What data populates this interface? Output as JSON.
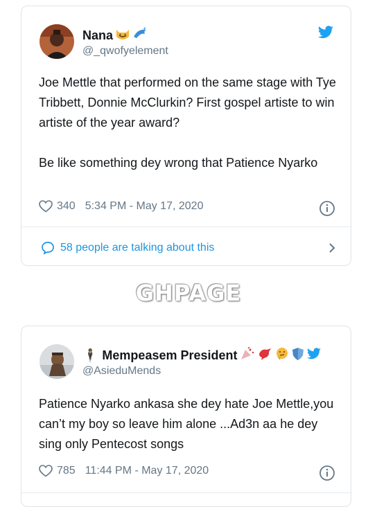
{
  "tweet1": {
    "name": "Nana",
    "handle": "@_qwofyelement",
    "text": "Joe Mettle that performed on the same stage with Tye Tribbett, Donnie McClurkin? First gospel artiste to win artiste of the year award?\n\nBe like something dey wrong that Patience Nyarko",
    "likes": "340",
    "timestamp": "5:34 PM - May 17, 2020",
    "talking": "58 people are talking about this"
  },
  "watermark": "GHPAGE",
  "tweet2": {
    "name_prefix": "🕴",
    "name": "Mempeasem President",
    "handle": "@AsieduMends",
    "text": "Patience Nyarko ankasa she dey hate Joe Mettle,you can’t my boy so leave him alone ...Ad3n aa he dey sing only Pentecost songs",
    "likes": "785",
    "timestamp": "11:44 PM - May 17, 2020"
  },
  "colors": {
    "twitter_blue": "#1da1f2",
    "link_blue": "#1b95e0",
    "secondary_text": "#657786",
    "border": "#dfe3e7"
  },
  "icons": [
    "twitter-bird-icon",
    "heart-icon",
    "info-icon",
    "speech-bubble-icon",
    "chevron-right-icon",
    "grinning-cat-emoji",
    "dolphin-emoji",
    "bird-emoji",
    "thinking-face-emoji",
    "shield-emoji"
  ]
}
